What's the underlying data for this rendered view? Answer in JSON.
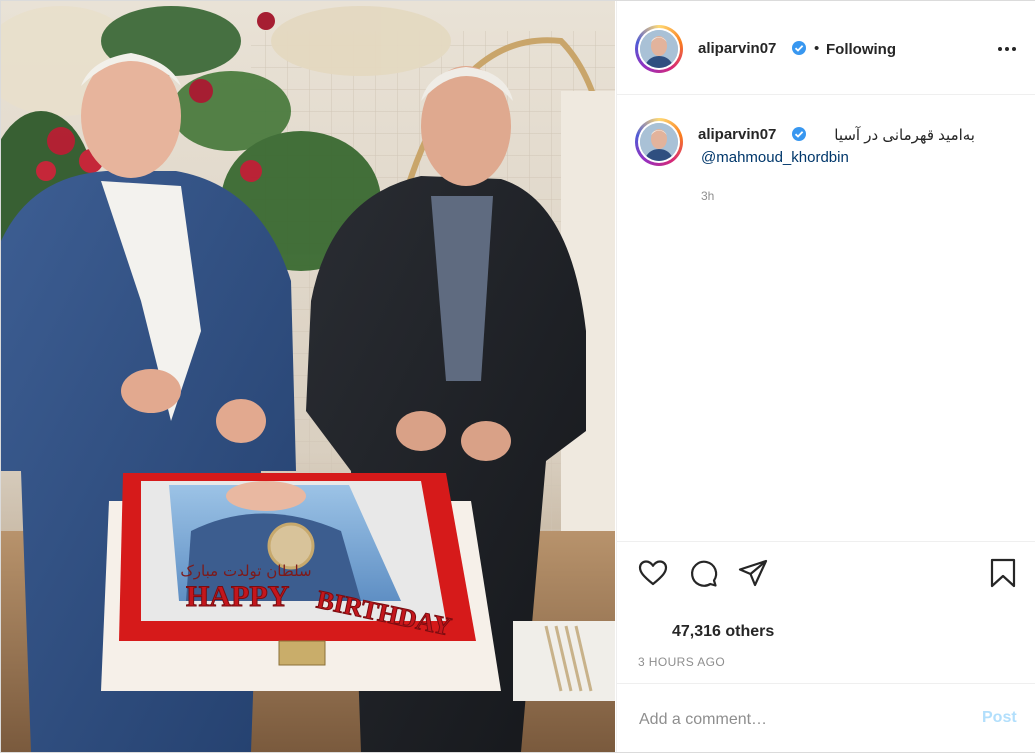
{
  "post": {
    "image_alt_icon": "photo-image",
    "cake_text_line1": "HAPPY",
    "cake_text_line2": "BIRTHDAY",
    "cake_caption": "سلطان تولدت مبارک"
  },
  "header": {
    "username": "aliparvin07",
    "verified_icon": "verified-badge-icon",
    "separator": "•",
    "follow_status": "Following",
    "more_icon": "more-options-icon"
  },
  "caption": {
    "username": "aliparvin07",
    "text": "به‌امید قهرمانی در آسیا",
    "mention": "@mahmoud_khordbin",
    "time": "3h"
  },
  "actions": {
    "like_icon": "heart-icon",
    "comment_icon": "comment-icon",
    "share_icon": "paper-plane-icon",
    "save_icon": "bookmark-icon",
    "likes": "47,316 others",
    "posted_time": "3 HOURS AGO"
  },
  "comment": {
    "placeholder": "Add a comment…",
    "post_label": "Post"
  },
  "colors": {
    "accent": "#3897f0",
    "mention": "#00376b",
    "muted": "#8e8e8e",
    "post_disabled": "#b2dffc"
  }
}
